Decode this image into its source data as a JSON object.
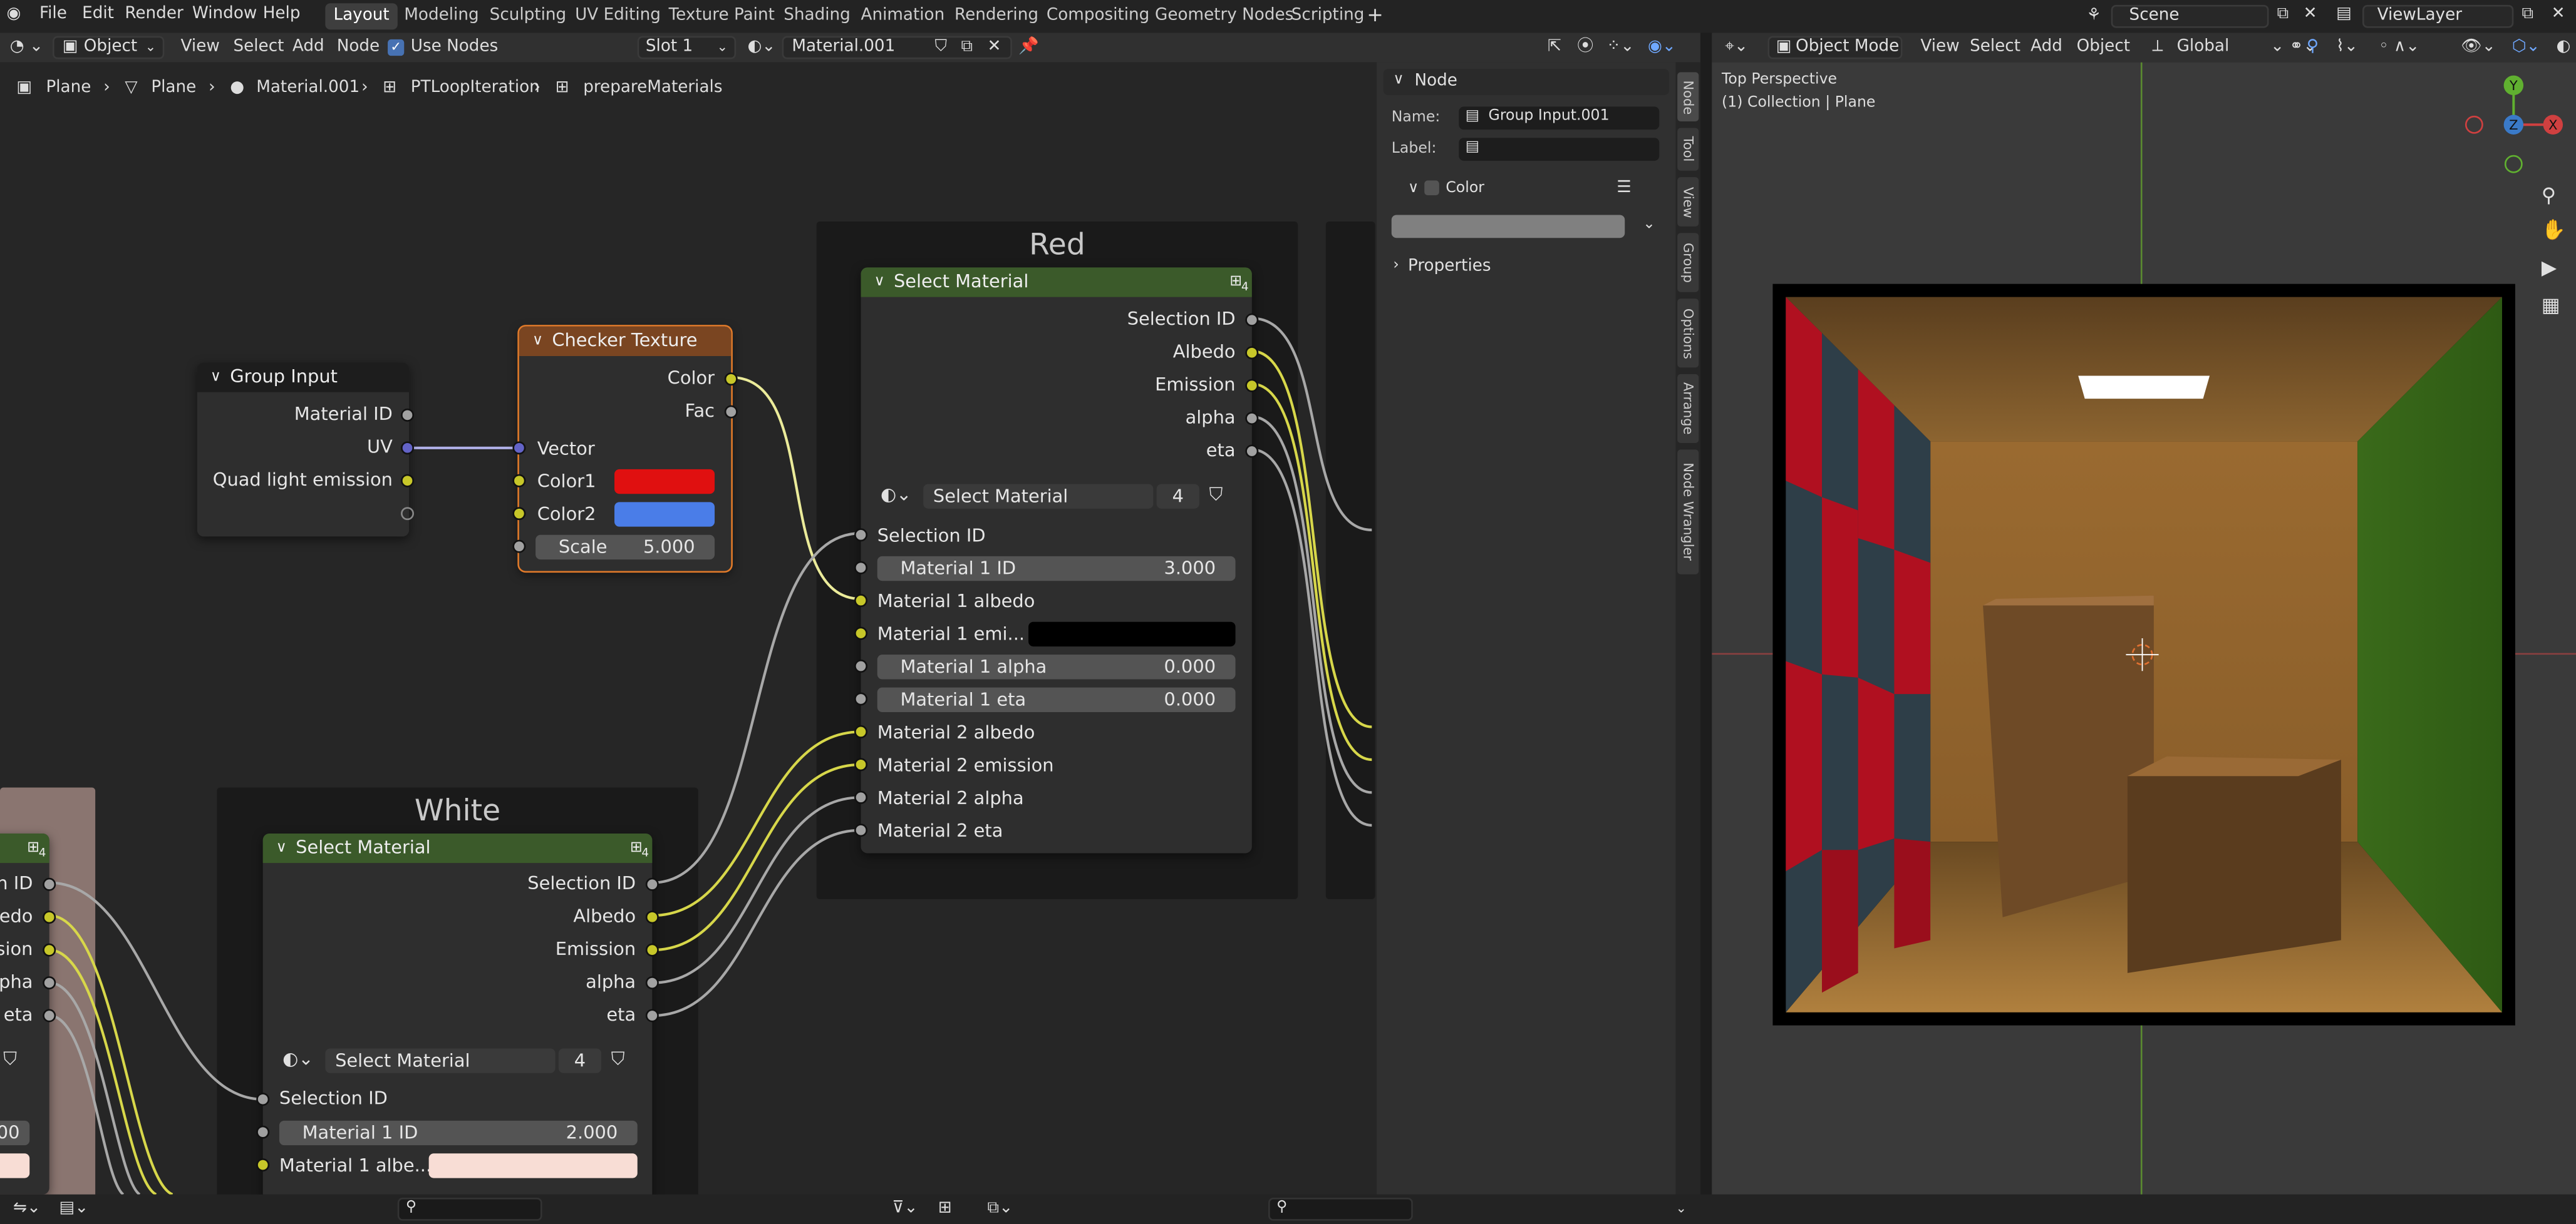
{
  "topbar": {
    "menus": [
      "File",
      "Edit",
      "Render",
      "Window",
      "Help"
    ],
    "workspaces": [
      "Layout",
      "Modeling",
      "Sculpting",
      "UV Editing",
      "Texture Paint",
      "Shading",
      "Animation",
      "Rendering",
      "Compositing",
      "Geometry Nodes",
      "Scripting"
    ],
    "active_workspace": "Layout",
    "add_tab": "+",
    "scene": "Scene",
    "view_layer": "ViewLayer"
  },
  "node_header": {
    "object_type": "Object",
    "menus": [
      "View",
      "Select",
      "Add",
      "Node"
    ],
    "use_nodes": "Use Nodes",
    "slot": "Slot 1",
    "material": "Material.001"
  },
  "breadcrumb": [
    "Plane",
    "Plane",
    "Material.001",
    "PTLoopIteration",
    "prepareMaterials"
  ],
  "frames": {
    "red": "Red",
    "white": "White"
  },
  "group_input": {
    "title": "Group Input",
    "outputs": [
      "Material ID",
      "UV",
      "Quad light emission"
    ]
  },
  "checker": {
    "title": "Checker Texture",
    "outputs": [
      "Color",
      "Fac"
    ],
    "input_vector": "Vector",
    "color1_label": "Color1",
    "color2_label": "Color2",
    "scale_label": "Scale",
    "scale_value": "5.000",
    "color1": "#e01010",
    "color2": "#4a7de8"
  },
  "red_node": {
    "title": "Select Material",
    "badge": "4",
    "outputs": [
      "Selection ID",
      "Albedo",
      "Emission",
      "alpha",
      "eta"
    ],
    "group_name": "Select Material",
    "users": "4",
    "inputs": {
      "selection_id": "Selection ID",
      "m1_id_label": "Material 1 ID",
      "m1_id": "3.000",
      "m1_albedo": "Material 1 albedo",
      "m1_emission": "Material 1 emi...",
      "m1_alpha_label": "Material 1 alpha",
      "m1_alpha": "0.000",
      "m1_eta_label": "Material 1 eta",
      "m1_eta": "0.000",
      "m2_albedo": "Material 2 albedo",
      "m2_emission": "Material 2 emission",
      "m2_alpha": "Material 2 alpha",
      "m2_eta": "Material 2 eta"
    }
  },
  "white_node": {
    "title": "Select Material",
    "badge": "4",
    "outputs": [
      "Selection ID",
      "Albedo",
      "Emission",
      "alpha",
      "eta"
    ],
    "group_name": "Select Material",
    "users": "4",
    "selection_id": "Selection ID",
    "m1_id_label": "Material 1 ID",
    "m1_id": "2.000",
    "m1_albedo": "Material 1 albe...",
    "albedo_color": "#f8ddd5"
  },
  "left_node": {
    "badge": "4",
    "outputs": [
      "n ID",
      "bedo",
      "ssion",
      "lpha",
      "eta"
    ],
    "field_value": "00"
  },
  "sidebar": {
    "section": "Node",
    "name_label": "Name:",
    "name_value": "Group Input.001",
    "label_label": "Label:",
    "color_label": "Color",
    "properties": "Properties",
    "tabs": [
      "Node",
      "Tool",
      "View",
      "Group",
      "Options",
      "Arrange",
      "Node Wrangler"
    ]
  },
  "viewport": {
    "mode": "Object Mode",
    "menus": [
      "View",
      "Select",
      "Add",
      "Object"
    ],
    "orientation": "Global",
    "perspective": "Top Perspective",
    "collection": "(1) Collection | Plane",
    "axes": {
      "x": "X",
      "y": "Y",
      "z": "Z"
    }
  }
}
